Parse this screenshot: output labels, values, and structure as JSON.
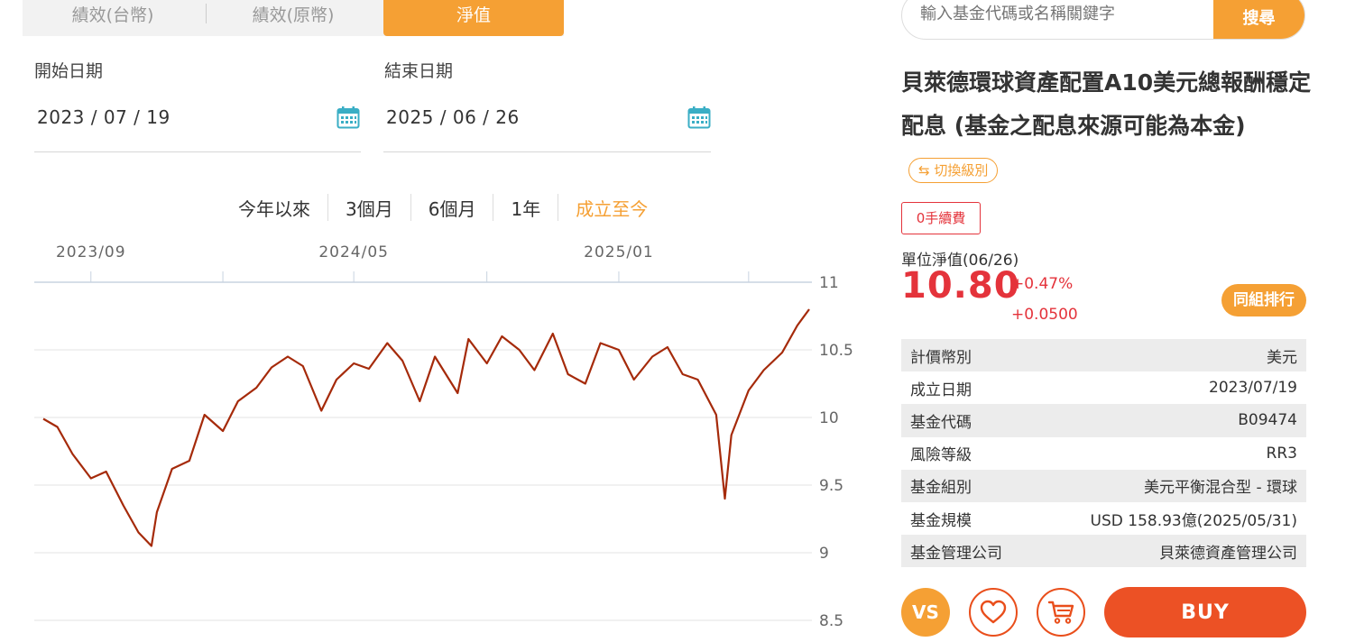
{
  "tabs": [
    {
      "label": "績效(台幣)"
    },
    {
      "label": "績效(原幣)"
    },
    {
      "label": "淨值"
    }
  ],
  "dates": {
    "start_label": "開始日期",
    "start_value": "2023 / 07 / 19",
    "end_label": "結束日期",
    "end_value": "2025 / 06 / 26"
  },
  "range_buttons": [
    {
      "label": "今年以來"
    },
    {
      "label": "3個月"
    },
    {
      "label": "6個月"
    },
    {
      "label": "1年"
    },
    {
      "label": "成立至今",
      "active": true
    }
  ],
  "chart_data": {
    "type": "line",
    "x_tick_labels": [
      "2023/09",
      "2024/05",
      "2025/01"
    ],
    "y_tick_labels": [
      "11",
      "10.5",
      "10",
      "9.5",
      "9",
      "8.5"
    ],
    "ylim": [
      8.5,
      11
    ],
    "y_axis_side": "right",
    "grid": true,
    "line_color": "#a52a0a",
    "series": [
      {
        "name": "",
        "x": [
          "2023-07-19",
          "2023-08-01",
          "2023-08-15",
          "2023-09-01",
          "2023-09-15",
          "2023-10-01",
          "2023-10-15",
          "2023-10-27",
          "2023-11-01",
          "2023-11-15",
          "2023-12-01",
          "2023-12-15",
          "2024-01-01",
          "2024-01-15",
          "2024-02-01",
          "2024-02-15",
          "2024-03-01",
          "2024-03-15",
          "2024-04-01",
          "2024-04-15",
          "2024-05-01",
          "2024-05-15",
          "2024-06-01",
          "2024-06-15",
          "2024-07-01",
          "2024-07-15",
          "2024-08-05",
          "2024-08-15",
          "2024-09-01",
          "2024-09-15",
          "2024-10-01",
          "2024-10-15",
          "2024-11-01",
          "2024-11-15",
          "2024-12-01",
          "2024-12-15",
          "2025-01-01",
          "2025-01-15",
          "2025-02-01",
          "2025-02-15",
          "2025-03-01",
          "2025-03-15",
          "2025-04-01",
          "2025-04-09",
          "2025-04-15",
          "2025-05-01",
          "2025-05-15",
          "2025-06-01",
          "2025-06-15",
          "2025-06-26"
        ],
        "values": [
          9.99,
          9.93,
          9.73,
          9.55,
          9.6,
          9.35,
          9.15,
          9.05,
          9.3,
          9.62,
          9.68,
          10.02,
          9.9,
          10.12,
          10.22,
          10.37,
          10.45,
          10.38,
          10.05,
          10.28,
          10.4,
          10.36,
          10.55,
          10.42,
          10.12,
          10.45,
          10.18,
          10.58,
          10.4,
          10.6,
          10.5,
          10.35,
          10.62,
          10.32,
          10.25,
          10.55,
          10.5,
          10.28,
          10.45,
          10.52,
          10.32,
          10.28,
          10.02,
          9.4,
          9.87,
          10.2,
          10.35,
          10.48,
          10.68,
          10.8
        ]
      }
    ]
  },
  "search": {
    "placeholder": "輸入基金代碼或名稱關鍵字",
    "button_label": "搜尋"
  },
  "fund": {
    "name": "貝萊德環球資產配置A10美元總報酬穩定配息 (基金之配息來源可能為本金)",
    "switch_label": "⇆ 切換級別",
    "fee_badge": "0手續費",
    "nav_label": "單位淨值(06/26)",
    "nav_value": "10.80",
    "change_pct": "+0.47%",
    "change_abs": "+0.0500",
    "rank_button": "同組排行",
    "info": [
      {
        "label": "計價幣別",
        "value": "美元"
      },
      {
        "label": "成立日期",
        "value": "2023/07/19"
      },
      {
        "label": "基金代碼",
        "value": "B09474"
      },
      {
        "label": "風險等級",
        "value": "RR3"
      },
      {
        "label": "基金組別",
        "value": "美元平衡混合型 - 環球"
      },
      {
        "label": "基金規模",
        "value": "USD 158.93億(2025/05/31)"
      },
      {
        "label": "基金管理公司",
        "value": "貝萊德資產管理公司"
      }
    ]
  },
  "actions": {
    "vs_label": "VS",
    "buy_label": "BUY"
  },
  "colors": {
    "accent": "#f5a034",
    "up_red": "#e4333b",
    "buy": "#ec5125"
  }
}
